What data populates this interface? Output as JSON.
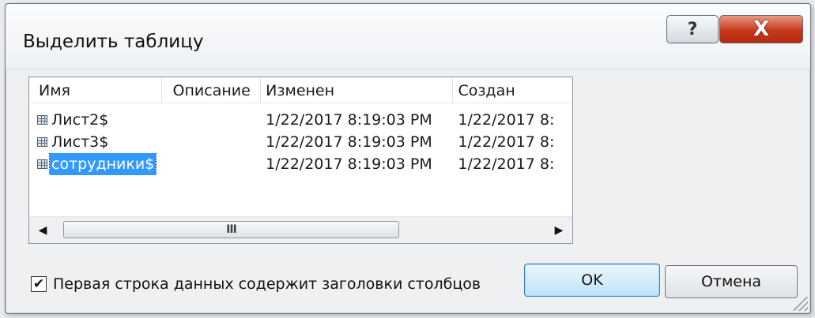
{
  "dialog": {
    "title": "Выделить таблицу",
    "help_label": "?",
    "close_label": "X"
  },
  "list": {
    "columns": [
      "Имя",
      "Описание",
      "Изменен",
      "Создан"
    ],
    "rows": [
      {
        "name": "Лист2$",
        "description": "",
        "modified": "1/22/2017 8:19:03 PM",
        "created": "1/22/2017 8:",
        "selected": false
      },
      {
        "name": "Лист3$",
        "description": "",
        "modified": "1/22/2017 8:19:03 PM",
        "created": "1/22/2017 8:",
        "selected": false
      },
      {
        "name": "сотрудники$",
        "description": "",
        "modified": "1/22/2017 8:19:03 PM",
        "created": "1/22/2017 8:",
        "selected": true
      }
    ],
    "row_icon": "table-icon",
    "scrollbar": {
      "left_arrow": "◀",
      "right_arrow": "▶",
      "thumb_grip": "III"
    }
  },
  "options": {
    "first_row_headers_label": "Первая строка данных содержит заголовки столбцов",
    "first_row_headers_checked": true,
    "check_mark": "✔"
  },
  "buttons": {
    "ok_label": "OK",
    "cancel_label": "Отмена"
  }
}
